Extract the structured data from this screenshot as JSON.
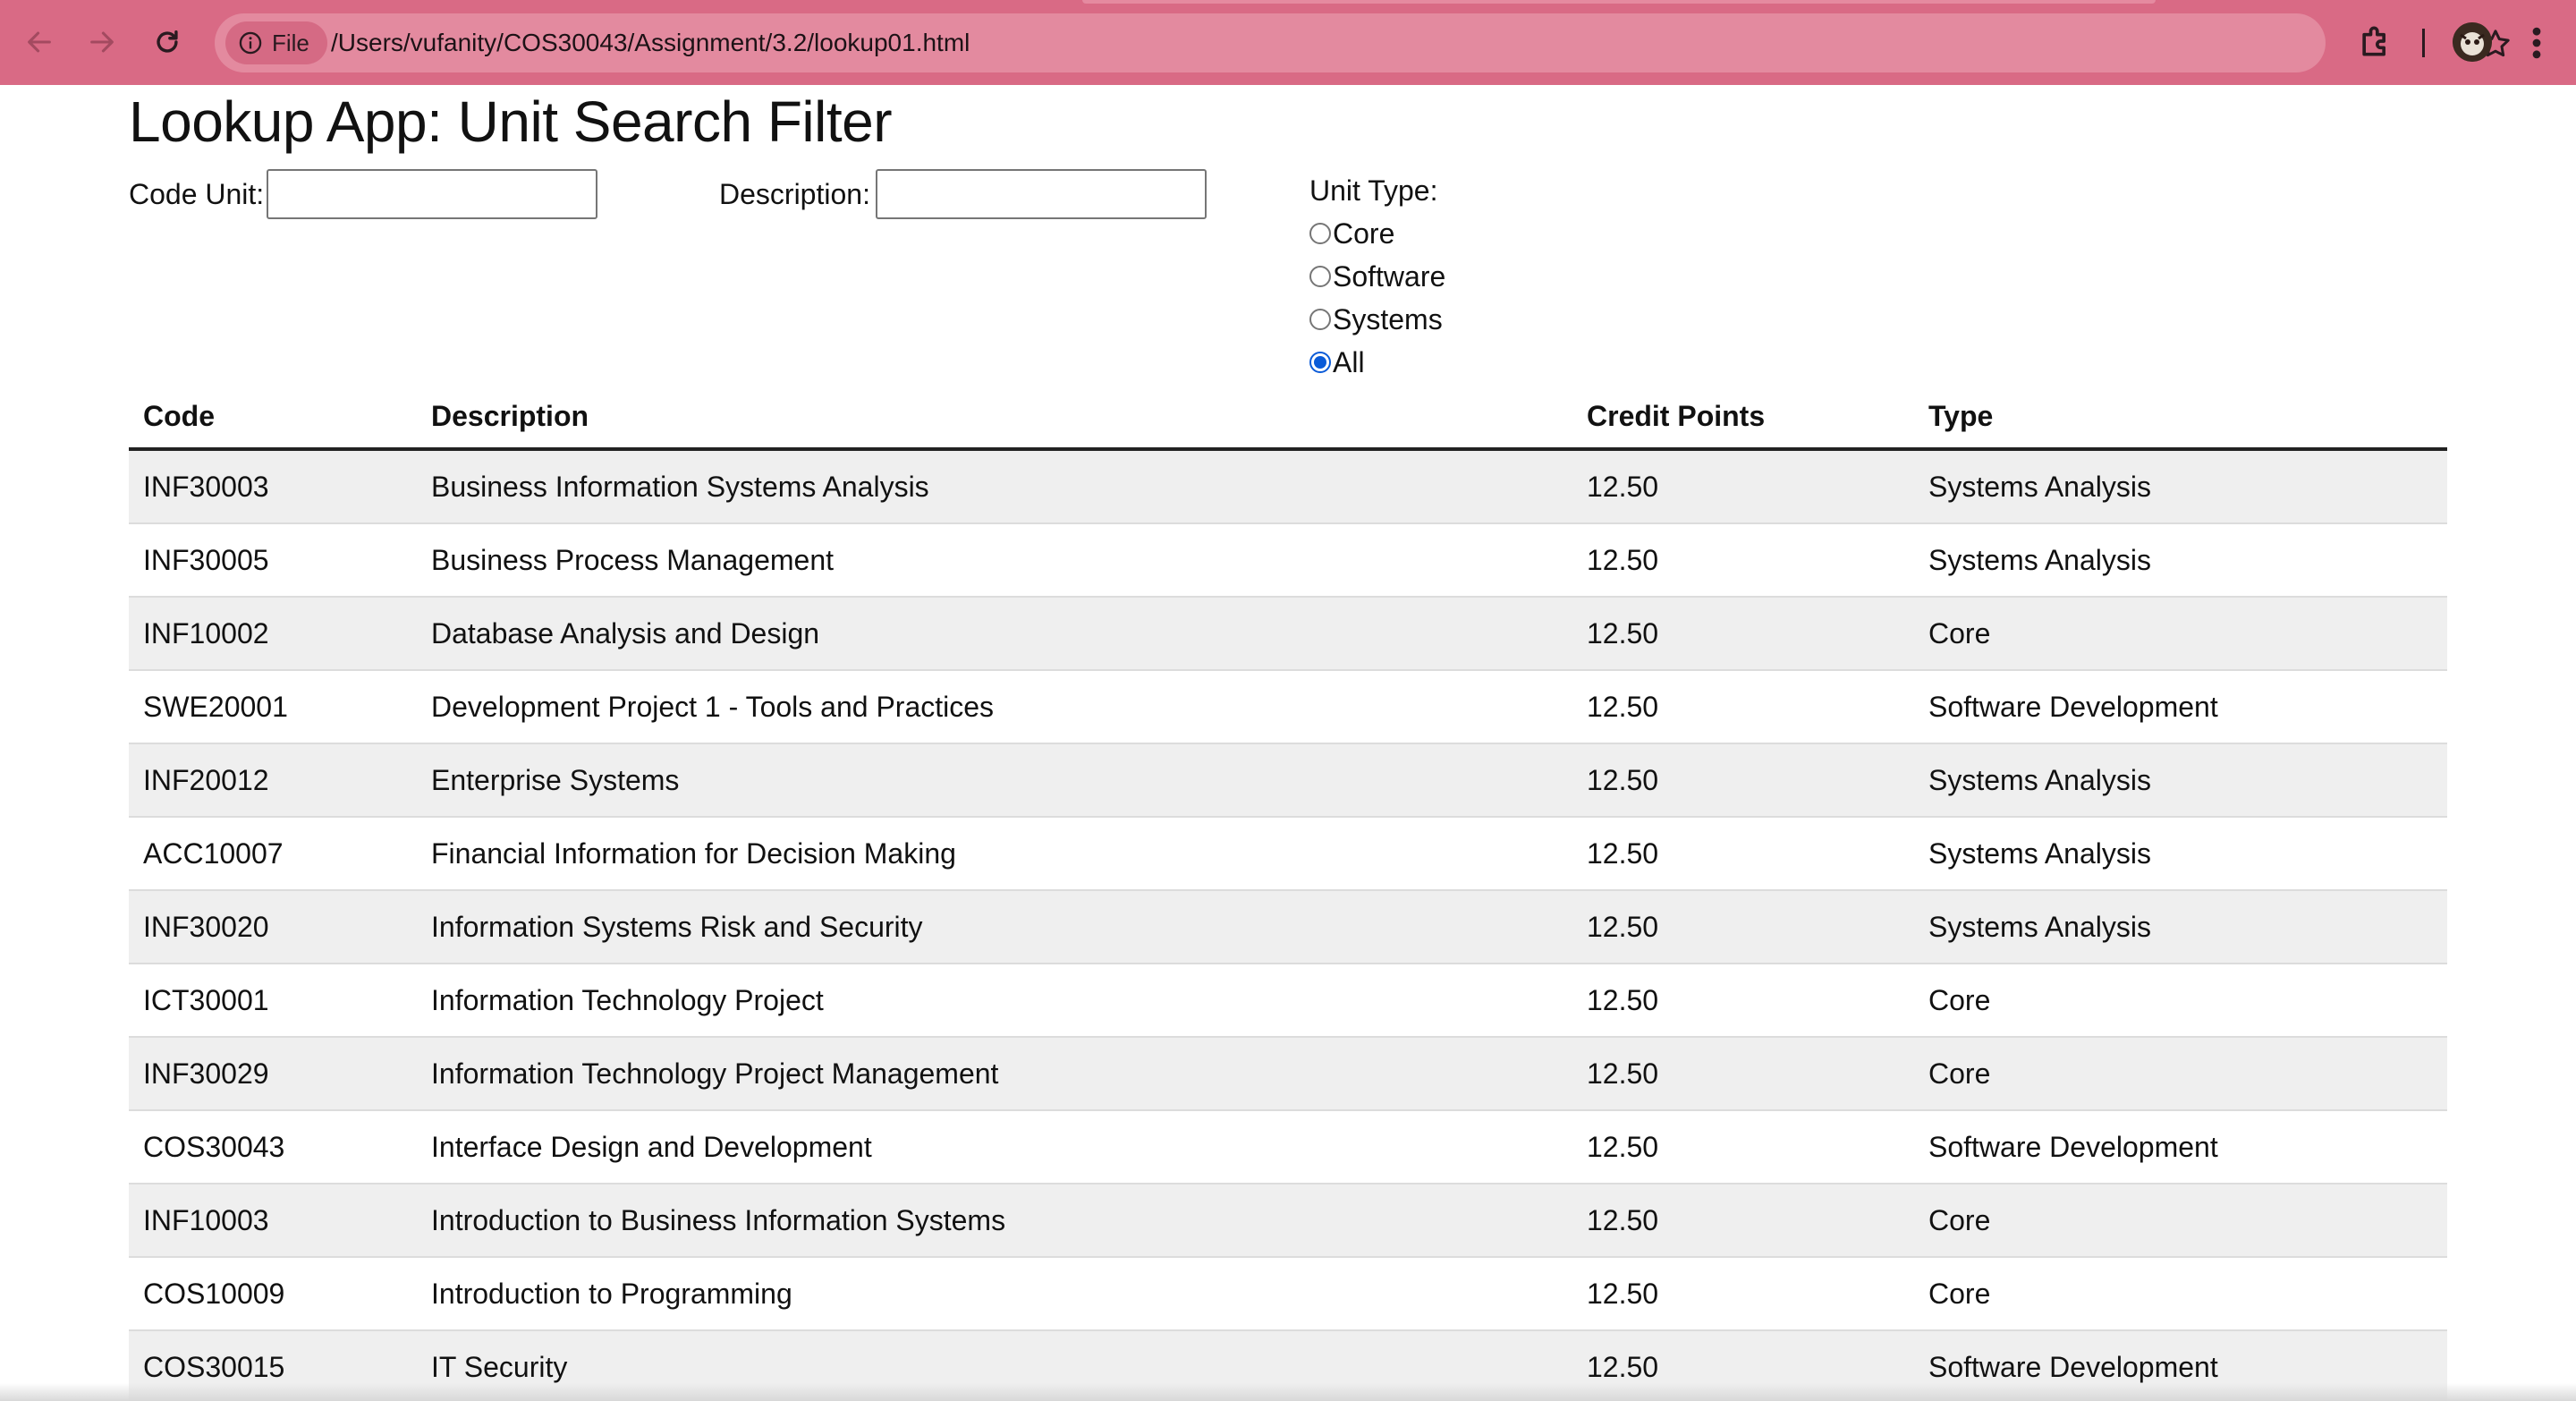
{
  "browser": {
    "file_chip_label": "File",
    "url": "/Users/vufanity/COS30043/Assignment/3.2/lookup01.html",
    "icons": [
      "back-icon",
      "forward-icon",
      "reload-icon",
      "info-icon",
      "star-icon",
      "extensions-icon",
      "avatar",
      "more-menu-icon"
    ]
  },
  "page": {
    "title": "Lookup App: Unit Search Filter",
    "code_unit_label": "Code Unit:",
    "code_unit_value": "",
    "description_label": "Description:",
    "description_value": "",
    "unit_type_label": "Unit Type:",
    "unit_type_options": [
      {
        "label": "Core",
        "checked": false
      },
      {
        "label": "Software",
        "checked": false
      },
      {
        "label": "Systems",
        "checked": false
      },
      {
        "label": "All",
        "checked": true
      }
    ]
  },
  "table": {
    "headers": [
      "Code",
      "Description",
      "Credit Points",
      "Type"
    ],
    "rows": [
      [
        "INF30003",
        "Business Information Systems Analysis",
        "12.50",
        "Systems Analysis"
      ],
      [
        "INF30005",
        "Business Process Management",
        "12.50",
        "Systems Analysis"
      ],
      [
        "INF10002",
        "Database Analysis and Design",
        "12.50",
        "Core"
      ],
      [
        "SWE20001",
        "Development Project 1 - Tools and Practices",
        "12.50",
        "Software Development"
      ],
      [
        "INF20012",
        "Enterprise Systems",
        "12.50",
        "Systems Analysis"
      ],
      [
        "ACC10007",
        "Financial Information for Decision Making",
        "12.50",
        "Systems Analysis"
      ],
      [
        "INF30020",
        "Information Systems Risk and Security",
        "12.50",
        "Systems Analysis"
      ],
      [
        "ICT30001",
        "Information Technology Project",
        "12.50",
        "Core"
      ],
      [
        "INF30029",
        "Information Technology Project Management",
        "12.50",
        "Core"
      ],
      [
        "COS30043",
        "Interface Design and Development",
        "12.50",
        "Software Development"
      ],
      [
        "INF10003",
        "Introduction to Business Information Systems",
        "12.50",
        "Core"
      ],
      [
        "COS10009",
        "Introduction to Programming",
        "12.50",
        "Core"
      ],
      [
        "COS30015",
        "IT Security",
        "12.50",
        "Software Development"
      ]
    ]
  },
  "colors": {
    "browser_bar": "#d96a85",
    "radio_accent": "#0a5bd8",
    "row_stripe": "#efefef"
  }
}
